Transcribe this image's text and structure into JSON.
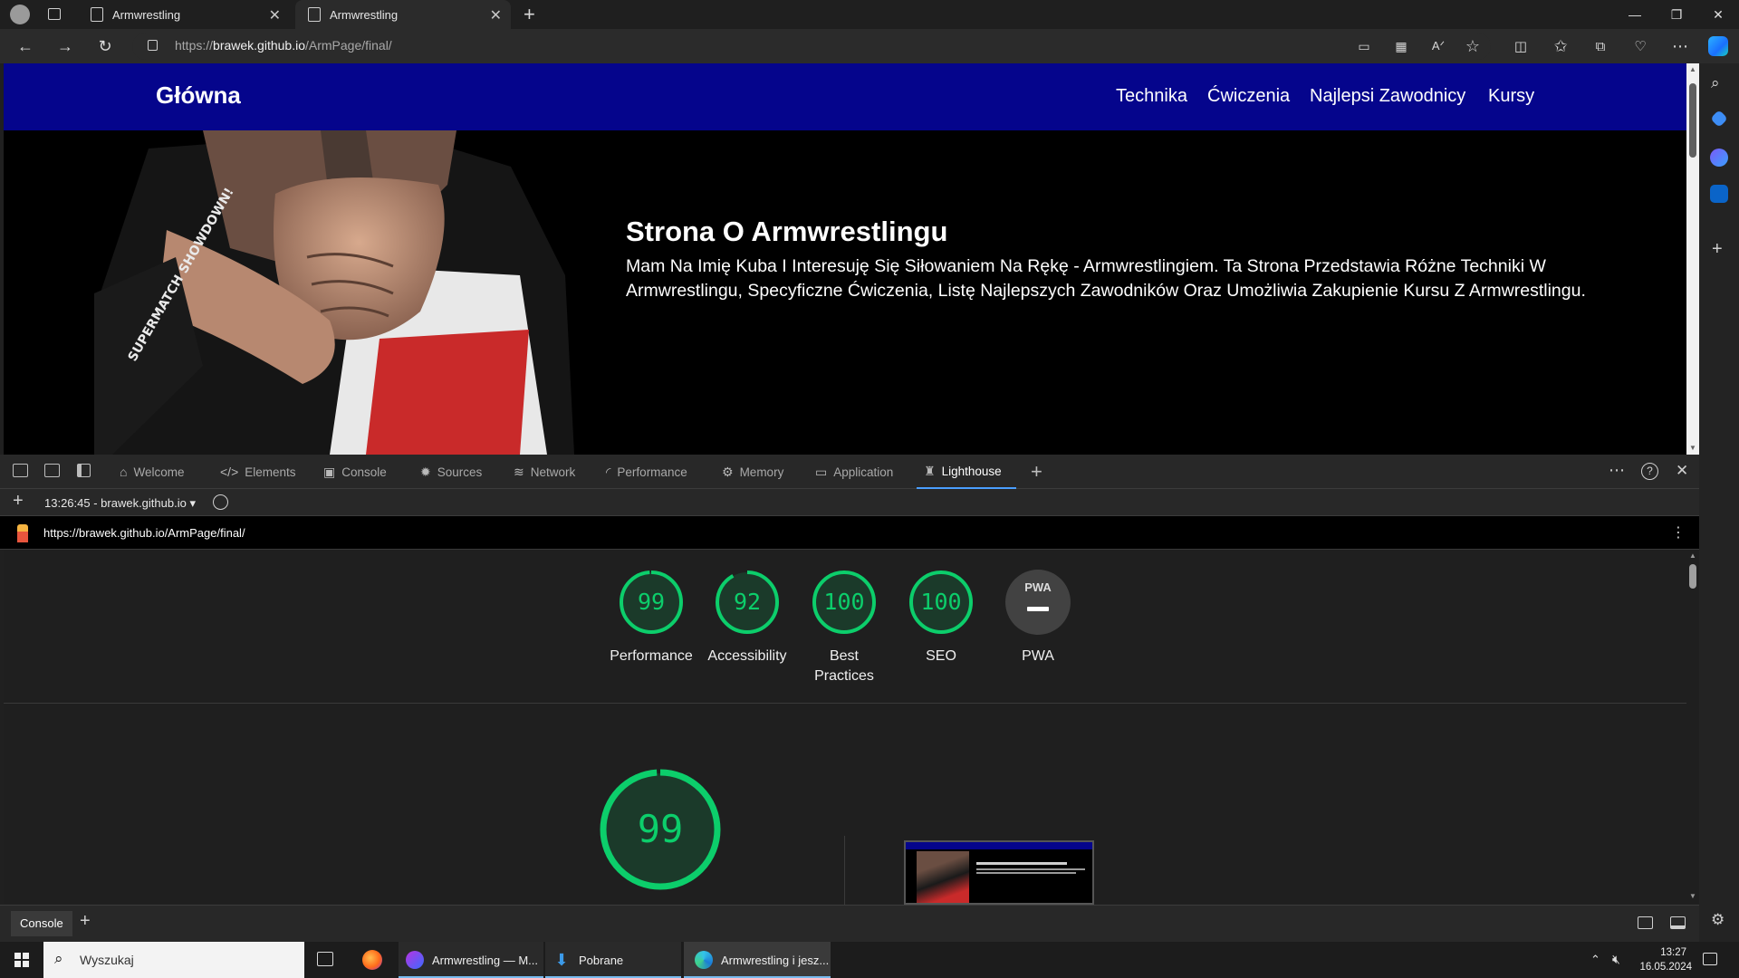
{
  "browser": {
    "tabs": [
      {
        "title": "Armwrestling"
      },
      {
        "title": "Armwrestling"
      }
    ],
    "address": {
      "prefix": "https://",
      "host": "brawek.github.io",
      "path": "/ArmPage/final/"
    }
  },
  "site": {
    "brand": "Główna",
    "nav": [
      "Technika",
      "Ćwiczenia",
      "Najlepsi Zawodnicy",
      "Kursy"
    ],
    "hero": {
      "title": "Strona O Armwrestlingu",
      "text": "Mam Na Imię Kuba I Interesuję Się Siłowaniem Na Rękę - Armwrestlingiem. Ta Strona Przedstawia Różne Techniki W Armwrestlingu, Specyficzne Ćwiczenia, Listę Najlepszych Zawodników Oraz Umożliwia Zakupienie Kursu Z Armwrestlingu.",
      "shirt_text": "SUPERMATCH SHOWDOWN!"
    },
    "colors": {
      "nav_bg": "#05058c",
      "hero_bg": "#000000"
    }
  },
  "devtools": {
    "tabs": [
      {
        "label": "Welcome",
        "icon": "home-icon"
      },
      {
        "label": "Elements",
        "icon": "code-icon"
      },
      {
        "label": "Console",
        "icon": "console-icon"
      },
      {
        "label": "Sources",
        "icon": "bug-icon"
      },
      {
        "label": "Network",
        "icon": "wifi-icon"
      },
      {
        "label": "Performance",
        "icon": "gauge-icon"
      },
      {
        "label": "Memory",
        "icon": "chip-icon"
      },
      {
        "label": "Application",
        "icon": "window-icon"
      },
      {
        "label": "Lighthouse",
        "icon": "lighthouse-icon"
      }
    ],
    "active_tab": "Lighthouse",
    "report_select": "13:26:45 - brawek.github.io",
    "report_url": "https://brawek.github.io/ArmPage/final/",
    "scores": [
      {
        "label": "Performance",
        "value": 99
      },
      {
        "label": "Accessibility",
        "value": 92
      },
      {
        "label": "Best Practices",
        "value": 100
      },
      {
        "label": "SEO",
        "value": 100
      },
      {
        "label": "PWA",
        "value": null,
        "badge": "PWA"
      }
    ],
    "main_score": "99",
    "drawer_tab": "Console",
    "colors": {
      "pass": "#0cce6b",
      "accent": "#4a9fff"
    }
  },
  "taskbar": {
    "search_placeholder": "Wyszukaj",
    "apps": [
      {
        "label": "Armwrestling — M...",
        "icon": "firefox-dev-icon"
      },
      {
        "label": "Pobrane",
        "icon": "download-icon"
      },
      {
        "label": "Armwrestling i jesz...",
        "icon": "edge-icon"
      }
    ],
    "time": "13:27",
    "date": "16.05.2024"
  }
}
